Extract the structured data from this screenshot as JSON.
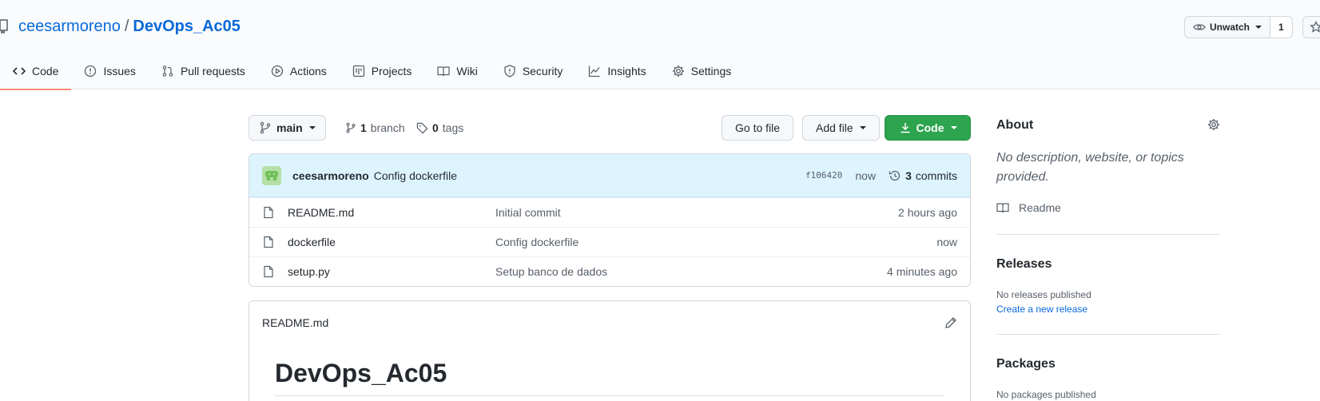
{
  "repo": {
    "owner": "ceesarmoreno",
    "separator": "/",
    "name": "DevOps_Ac05"
  },
  "watch": {
    "label": "Unwatch",
    "count": "1"
  },
  "tabs": [
    {
      "label": "Code",
      "icon": "code-icon",
      "selected": true
    },
    {
      "label": "Issues",
      "icon": "issue-icon"
    },
    {
      "label": "Pull requests",
      "icon": "pull-request-icon"
    },
    {
      "label": "Actions",
      "icon": "play-icon"
    },
    {
      "label": "Projects",
      "icon": "project-icon"
    },
    {
      "label": "Wiki",
      "icon": "book-icon"
    },
    {
      "label": "Security",
      "icon": "shield-icon"
    },
    {
      "label": "Insights",
      "icon": "graph-icon"
    },
    {
      "label": "Settings",
      "icon": "gear-icon"
    }
  ],
  "toolbar": {
    "branch": "main",
    "branch_count": "1",
    "branch_label": "branch",
    "tag_count": "0",
    "tag_label": "tags",
    "go_to_file": "Go to file",
    "add_file": "Add file",
    "code": "Code"
  },
  "latest_commit": {
    "author": "ceesarmoreno",
    "message": "Config dockerfile",
    "sha": "f106420",
    "time": "now",
    "commit_count": "3",
    "commit_label": "commits"
  },
  "files": [
    {
      "name": "README.md",
      "message": "Initial commit",
      "age": "2 hours ago"
    },
    {
      "name": "dockerfile",
      "message": "Config dockerfile",
      "age": "now"
    },
    {
      "name": "setup.py",
      "message": "Setup banco de dados",
      "age": "4 minutes ago"
    }
  ],
  "readme": {
    "filename": "README.md",
    "heading": "DevOps_Ac05"
  },
  "sidebar": {
    "about_title": "About",
    "about_description": "No description, website, or topics provided.",
    "readme_link": "Readme",
    "releases_title": "Releases",
    "releases_text": "No releases published",
    "releases_link": "Create a new release",
    "packages_title": "Packages",
    "packages_text": "No packages published"
  },
  "colors": {
    "accent": "#0969da",
    "primary_button": "#2da44e",
    "tab_underline": "#fd8c73",
    "commit_bar": "#ddf4ff"
  }
}
